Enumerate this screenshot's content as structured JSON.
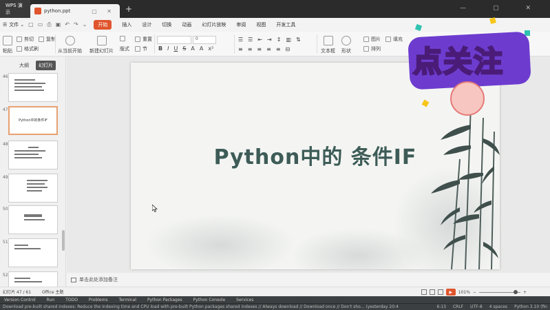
{
  "titlebar": {
    "app_tab": "WPS 演示",
    "doc_tab": "python.ppt",
    "new_tab": "+"
  },
  "menu": {
    "file": "文件",
    "items": [
      "开始",
      "插入",
      "设计",
      "切换",
      "动画",
      "幻灯片放映",
      "审阅",
      "视图",
      "开发工具"
    ],
    "active_index": 0
  },
  "ribbon": {
    "paste": "粘贴",
    "cut": "剪切",
    "copy": "复制",
    "format_painter": "格式刷",
    "from_current": "从当前开始",
    "new_slide": "新建幻灯片",
    "layout": "版式",
    "reset": "重置",
    "section": "节",
    "font_size_value": "0",
    "bold": "B",
    "italic": "I",
    "underline": "U",
    "strike": "S",
    "text_box": "文本框",
    "shape": "形状",
    "arrange": "排列",
    "picture": "图片",
    "fill": "填充"
  },
  "panel": {
    "tabs": [
      "大纲",
      "幻灯片"
    ],
    "active_tab": 1,
    "thumbnails": [
      {
        "num": "46",
        "title": ""
      },
      {
        "num": "47",
        "title": "Python中的条件IF"
      },
      {
        "num": "48",
        "title": ""
      },
      {
        "num": "49",
        "title": ""
      },
      {
        "num": "50",
        "title": ""
      },
      {
        "num": "51",
        "title": ""
      },
      {
        "num": "52",
        "title": ""
      }
    ]
  },
  "slide": {
    "title": "Python中的 条件IF"
  },
  "notes": {
    "placeholder": "单击此处添加备注"
  },
  "status": {
    "slide_count": "幻灯片 47 / 61",
    "theme": "Office 主题",
    "zoom": "101%"
  },
  "ide_tools": [
    "Version Control",
    "Run",
    "TODO",
    "Problems",
    "Terminal",
    "Python Packages",
    "Python Console",
    "Services"
  ],
  "ide_status": {
    "message": "Download pre-built shared indexes: Reduce the indexing time and CPU load with pre-built Python packages shared indexes // Always download // Download once // Don't sho... (yesterday 20:4",
    "position": "6:13",
    "line_ending": "CRLF",
    "encoding": "UTF-8",
    "indent": "4 spaces",
    "interpreter": "Python 3.10 (fin"
  },
  "sticker": {
    "text": "点关注"
  },
  "colors": {
    "accent": "#e0552d",
    "slide_title": "#3e5c57",
    "sticker_fill": "#f6c61b",
    "sticker_bg": "#6d3ccf"
  }
}
